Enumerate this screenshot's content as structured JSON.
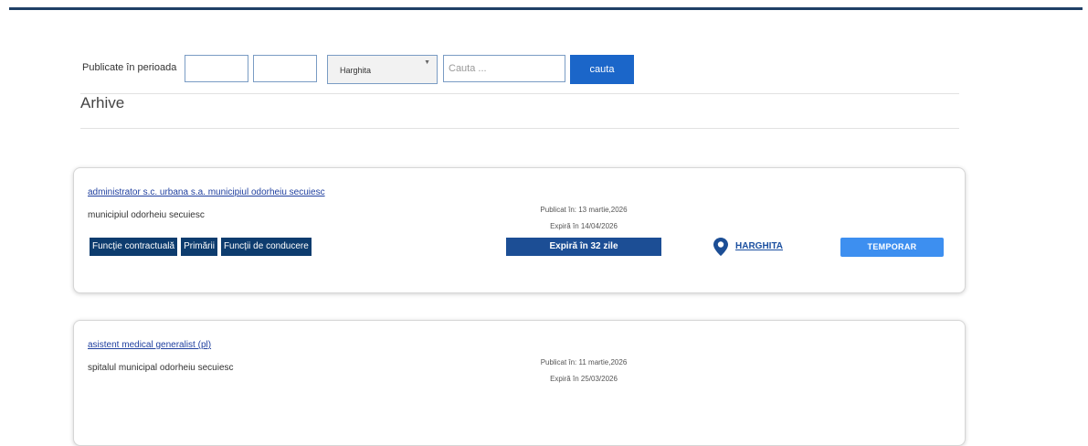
{
  "filter": {
    "label": "Publicate în perioada",
    "county_selected": "Harghita",
    "search_placeholder": "Cauta ...",
    "search_button": "cauta"
  },
  "section_title": "Arhive",
  "listings": [
    {
      "title": "administrator s.c. urbana s.a. municipiul odorheiu secuiesc",
      "employer": "municipiul odorheiu secuiesc",
      "tags": [
        "Funcție contractuală",
        "Primării",
        "Funcții de conducere"
      ],
      "published": "Publicat în: 13 martie,2026",
      "expires": "Expiră în 14/04/2026",
      "expiry_badge": "Expiră în 32 zile",
      "location": "HARGHITA",
      "type": "TEMPORAR"
    },
    {
      "title": "asistent medical generalist (pl)",
      "employer": "spitalul municipal odorheiu secuiesc",
      "published": "Publicat în: 11 martie,2026",
      "expires": "Expiră în 25/03/2026"
    }
  ],
  "colors": {
    "top_bar": "#1f3f66",
    "search_button": "#1b66c9",
    "tag_bg": "#0d3c6e",
    "expiry_badge": "#1c4e95",
    "type_button": "#3d8ff0",
    "link": "#1f3f9f"
  },
  "icons": {
    "location": "map-pin-icon",
    "dropdown": "dropdown-arrow-icon"
  }
}
